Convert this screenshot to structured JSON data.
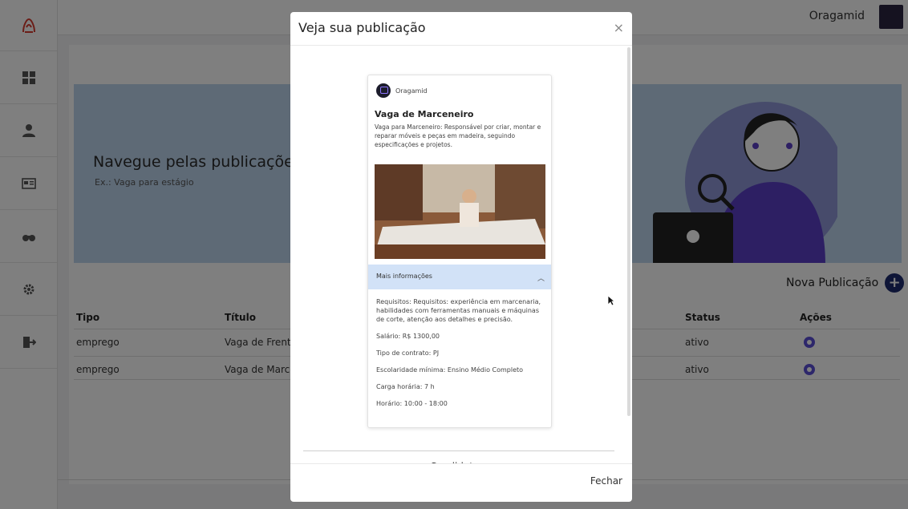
{
  "topbar": {
    "username": "Oragamid"
  },
  "sidebar": {
    "items": [
      {
        "icon": "dashboard-icon"
      },
      {
        "icon": "user-icon"
      },
      {
        "icon": "card-icon"
      },
      {
        "icon": "binoculars-icon"
      },
      {
        "icon": "gear-icon"
      },
      {
        "icon": "logout-icon"
      }
    ]
  },
  "hero": {
    "title": "Navegue pelas publicações",
    "search_placeholder": "Ex.: Vaga para estágio"
  },
  "actions": {
    "new_publication": "Nova Publicação"
  },
  "table": {
    "headers": {
      "tipo": "Tipo",
      "titulo": "Título",
      "status": "Status",
      "acoes": "Ações"
    },
    "rows": [
      {
        "tipo": "emprego",
        "titulo": "Vaga de Frentis",
        "status": "ativo"
      },
      {
        "tipo": "emprego",
        "titulo": "Vaga de Marce",
        "status": "ativo"
      }
    ]
  },
  "modal": {
    "title": "Veja sua publicação",
    "close_label": "×",
    "footer_button": "Fechar",
    "post": {
      "author": "Oragamid",
      "title": "Vaga de Marceneiro",
      "description": "Vaga para Marceneiro: Responsável por criar, montar e reparar móveis e peças em madeira, seguindo especificações e projetos.",
      "accordion_label": "Mais informações",
      "details": {
        "requisitos": "Requisitos: Requisitos: experiência em marcenaria, habilidades com ferramentas manuais e máquinas de corte, atenção aos detalhes e precisão.",
        "salario": "Salário: R$ 1300,00",
        "tipo_contrato": "Tipo de contrato: PJ",
        "escolaridade": "Escolaridade mínima: Ensino Médio Completo",
        "carga_horaria": "Carga horária: 7 h",
        "horario": "Horário: 10:00 - 18:00"
      }
    }
  },
  "colors": {
    "brand_red": "#d63a2f",
    "hero_bg": "#bcd4ec",
    "accent_blue": "#1c2a6e",
    "eye_purple": "#5b4fd6",
    "accordion_bg": "#d2e2f7"
  }
}
